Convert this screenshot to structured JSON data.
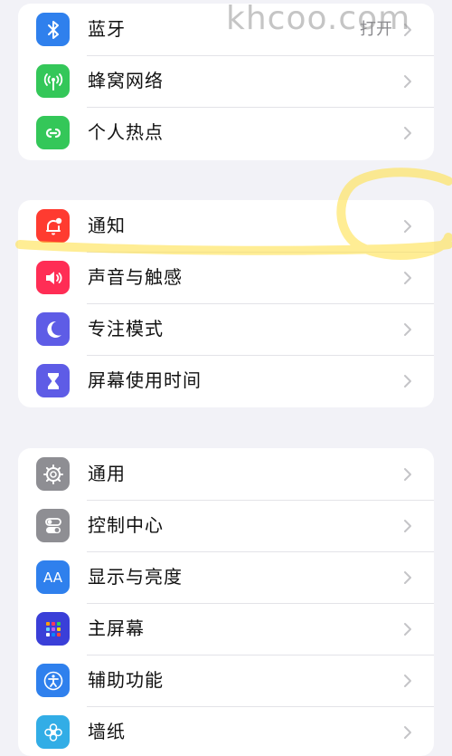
{
  "groups": [
    {
      "items": [
        {
          "label": "蓝牙",
          "value": "打开",
          "icon": "bluetooth-icon",
          "color": "#2f80ed"
        },
        {
          "label": "蜂窝网络",
          "icon": "cellular-antenna-icon",
          "color": "#34c759"
        },
        {
          "label": "个人热点",
          "icon": "personal-hotspot-icon",
          "color": "#34c759"
        }
      ]
    },
    {
      "items": [
        {
          "label": "通知",
          "icon": "notification-bell-icon",
          "color": "#ff3b30"
        },
        {
          "label": "声音与触感",
          "icon": "speaker-icon",
          "color": "#ff2d55"
        },
        {
          "label": "专注模式",
          "icon": "moon-icon",
          "color": "#5e5ce6"
        },
        {
          "label": "屏幕使用时间",
          "icon": "hourglass-icon",
          "color": "#5e5ce6"
        }
      ]
    },
    {
      "items": [
        {
          "label": "通用",
          "icon": "gear-icon",
          "color": "#8e8e93"
        },
        {
          "label": "控制中心",
          "icon": "toggle-switches-icon",
          "color": "#8e8e93"
        },
        {
          "label": "显示与亮度",
          "icon": "text-size-aa-icon",
          "color": "#2f80ed"
        },
        {
          "label": "主屏幕",
          "icon": "home-screen-grid-icon",
          "color": "#3a3fd8"
        },
        {
          "label": "辅助功能",
          "icon": "accessibility-icon",
          "color": "#2f80ed"
        },
        {
          "label": "墙纸",
          "icon": "wallpaper-flower-icon",
          "color": "#32ade6"
        }
      ]
    }
  ],
  "icons": {
    "aa_text": "AA"
  },
  "watermark": "khcoo.com",
  "highlight_color": "#ffe14d"
}
